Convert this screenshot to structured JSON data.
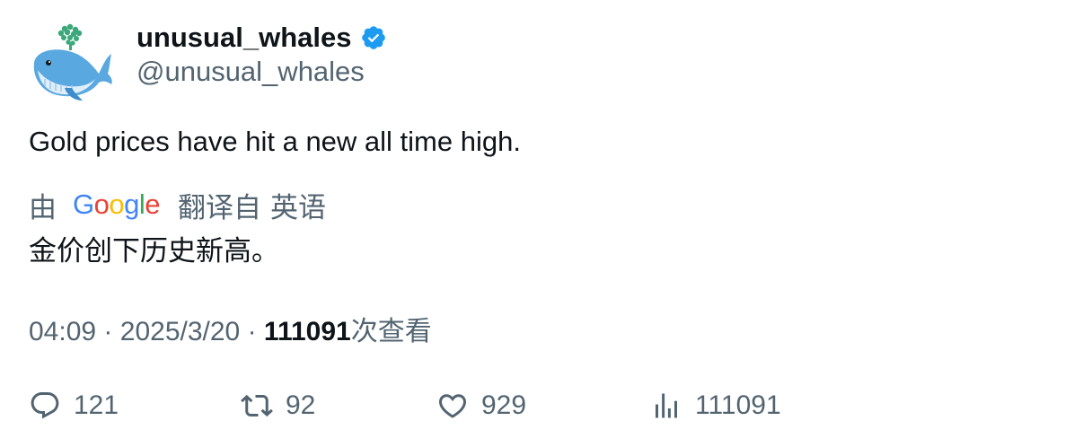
{
  "author": {
    "display_name": "unusual_whales",
    "handle": "@unusual_whales",
    "verified": true,
    "avatar_icon": "whale-avatar-icon"
  },
  "tweet": {
    "text": "Gold prices have hit a new all time high."
  },
  "translation": {
    "by_label": "由",
    "provider": "Google",
    "translated_from_label": "翻译自",
    "source_language": "英语",
    "text": "金价创下历史新高。"
  },
  "meta": {
    "time": "04:09",
    "date": "2025/3/20",
    "separator": "·",
    "views_count": "111091",
    "views_label": "次查看"
  },
  "actions": {
    "reply": {
      "icon": "reply-icon",
      "count": "121"
    },
    "retweet": {
      "icon": "retweet-icon",
      "count": "92"
    },
    "like": {
      "icon": "heart-icon",
      "count": "929"
    },
    "views": {
      "icon": "analytics-icon",
      "count": "111091"
    }
  },
  "colors": {
    "text_primary": "#0f1419",
    "text_secondary": "#536471",
    "verified_blue": "#1d9bf0"
  }
}
